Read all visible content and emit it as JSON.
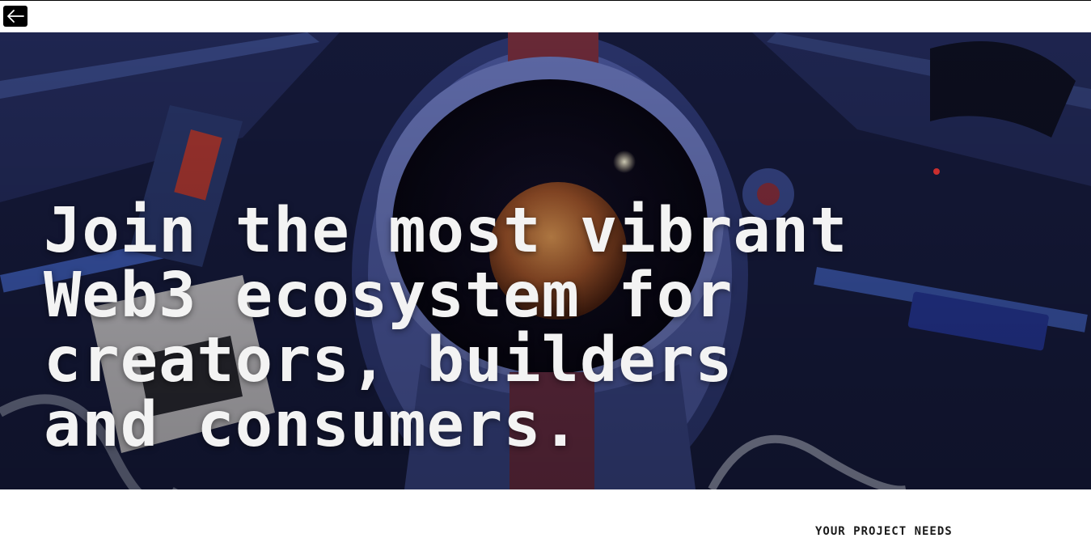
{
  "topbar": {
    "back_icon": "arrow-left-icon"
  },
  "hero": {
    "headline": "Join the most vibrant\nWeb3 ecosystem for\ncreators, builders\nand consumers.",
    "image": "astronaut-helmet-space-station-photo"
  },
  "section": {
    "cut_off_label": "YOUR PROJECT NEEDS"
  },
  "colors": {
    "hero_text": "#f3f3f3",
    "back_button_bg": "#000000",
    "page_bg": "#ffffff"
  }
}
